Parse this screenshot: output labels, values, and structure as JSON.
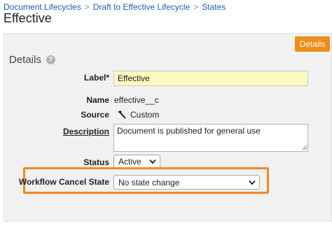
{
  "breadcrumb": {
    "items": [
      "Document Lifecycles",
      "Draft to Effective Lifecycle",
      "States"
    ],
    "separator": ">"
  },
  "page": {
    "title": "Effective"
  },
  "tabs": {
    "details_label": "Details"
  },
  "section": {
    "title": "Details",
    "help_icon": "?"
  },
  "fields": {
    "label": {
      "label": "Label*",
      "value": "Effective"
    },
    "name": {
      "label": "Name",
      "value": "effective__c"
    },
    "source": {
      "label": "Source",
      "value": "Custom",
      "icon": "hammer-icon"
    },
    "description": {
      "label": "Description",
      "value": "Document is published for general use"
    },
    "status": {
      "label": "Status",
      "value": "Active"
    },
    "workflow_cancel_state": {
      "label": "Workflow Cancel State",
      "value": "No state change"
    }
  },
  "colors": {
    "accent": "#f08c1a",
    "highlight": "#f28a1e",
    "link": "#1a5eb8",
    "label_bg": "#fcf9c0"
  }
}
